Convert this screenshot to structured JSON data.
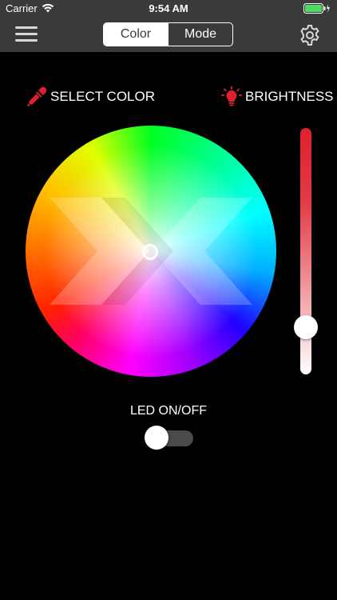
{
  "status_bar": {
    "carrier": "Carrier",
    "time": "9:54 AM",
    "battery_color": "#4cd964"
  },
  "nav": {
    "tabs": [
      {
        "label": "Color",
        "selected": true
      },
      {
        "label": "Mode",
        "selected": false
      }
    ],
    "menu_icon": "hamburger-menu-icon",
    "settings_icon": "gear-icon"
  },
  "labels": {
    "select_color": "SELECT COLOR",
    "brightness": "BRIGHTNESS",
    "led": "LED ON/OFF"
  },
  "icons": {
    "select_color": "color-dropper-icon",
    "brightness": "light-bulb-icon"
  },
  "colors": {
    "accent_red": "#e0202e",
    "bar_background": "#3a3a3a",
    "toggle_off": "#4a4a4a"
  },
  "brightness": {
    "level": 0.15
  },
  "led": {
    "on": false
  }
}
